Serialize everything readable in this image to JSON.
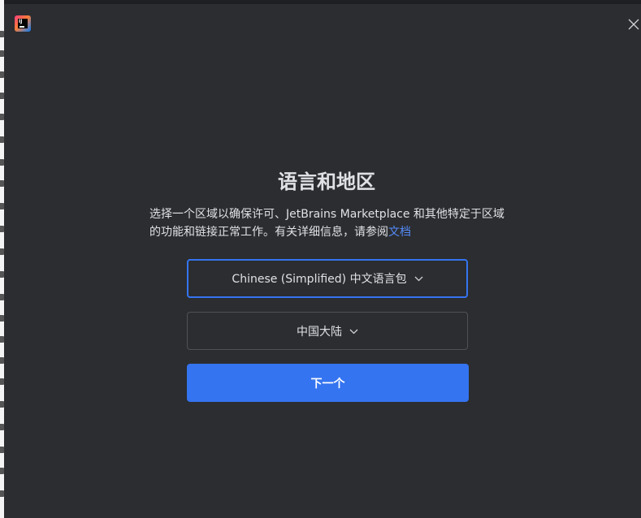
{
  "dialog": {
    "title": "语言和地区",
    "description_text": "选择一个区域以确保许可、JetBrains Marketplace 和其他特定于区域的功能和链接正常工作。有关详细信息，请参阅",
    "description_link": "文档",
    "language_select": {
      "value": "Chinese (Simplified) 中文语言包"
    },
    "region_select": {
      "value": "中国大陆"
    },
    "next_button_label": "下一个"
  },
  "colors": {
    "background": "#2b2d30",
    "text": "#dfe1e5",
    "accent": "#3574f0",
    "link": "#548af7",
    "border": "#4e5157"
  },
  "icons": {
    "app": "jetbrains-ij-logo-icon",
    "close": "close-icon",
    "chevron": "chevron-down-icon"
  }
}
